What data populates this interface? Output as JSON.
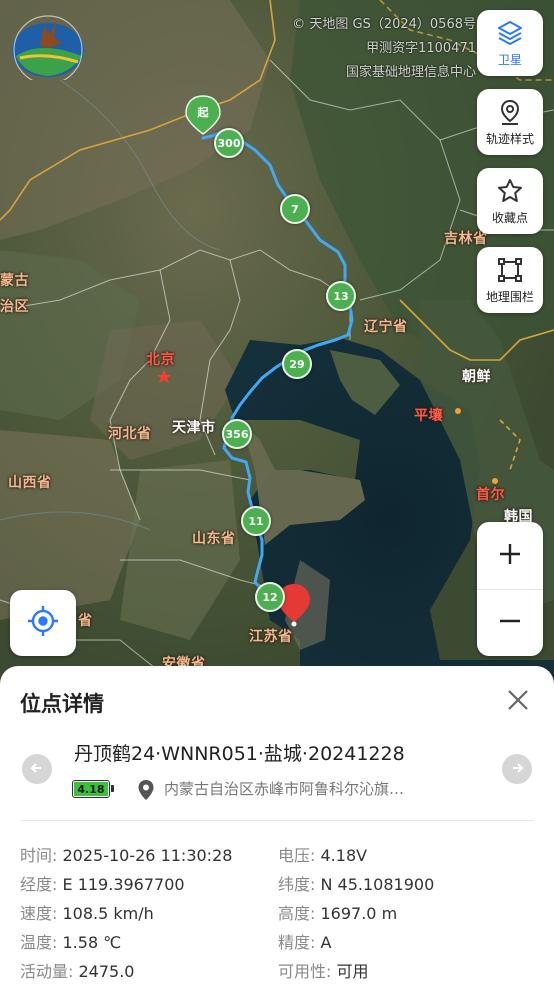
{
  "map": {
    "copyright": [
      "© 天地图 GS（2024）0568号",
      "甲测资字1100471",
      "国家基础地理信息中心"
    ],
    "labels": {
      "beijing": "北京",
      "tianjin": "天津市",
      "hebei": "河北省",
      "shanxi": "山西省",
      "shandong": "山东省",
      "liaoning": "辽宁省",
      "jilin": "吉林省",
      "chaoxian": "朝鲜",
      "pyongyang": "平壤",
      "seoul": "首尔",
      "hanguo": "韩国",
      "jiangsu": "江苏省",
      "anhui": "安徽省",
      "menggu": "蒙古",
      "zhiqu": "治区",
      "sheng_edge": "省"
    },
    "start_marker": "起",
    "clusters": [
      "300",
      "7",
      "13",
      "29",
      "356",
      "11",
      "12"
    ],
    "colors": {
      "track": "#3fa9f5",
      "cluster": "#4caf50",
      "end_pin": "#e53935",
      "start_pin": "#4caf50",
      "accent": "#2979ff"
    }
  },
  "side_buttons": {
    "satellite": {
      "label": "卫星",
      "icon": "layers-icon"
    },
    "track_style": {
      "label": "轨迹样式",
      "icon": "location-pin-icon"
    },
    "favorites": {
      "label": "收藏点",
      "icon": "star-icon"
    },
    "geofence": {
      "label": "地理围栏",
      "icon": "geofence-icon"
    }
  },
  "zoom": {
    "in": "+",
    "out": "−"
  },
  "panel": {
    "title": "位点详情",
    "device_name": "丹顶鹤24·WNNR051·盐城·20241228",
    "battery": "4.18",
    "location": "内蒙古自治区赤峰市阿鲁科尔沁旗…",
    "details": {
      "time": {
        "key": "时间:",
        "value": "2025-10-26 11:30:28"
      },
      "voltage": {
        "key": "电压:",
        "value": "4.18V"
      },
      "lng": {
        "key": "经度:",
        "value": "E 119.3967700"
      },
      "lat": {
        "key": "纬度:",
        "value": "N 45.1081900"
      },
      "speed": {
        "key": "速度:",
        "value": "108.5 km/h"
      },
      "altitude": {
        "key": "高度:",
        "value": "1697.0 m"
      },
      "temp": {
        "key": "温度:",
        "value": "1.58 ℃"
      },
      "accuracy": {
        "key": "精度:",
        "value": "A"
      },
      "activity": {
        "key": "活动量:",
        "value": "2475.0"
      },
      "usable": {
        "key": "可用性:",
        "value": "可用"
      }
    }
  }
}
